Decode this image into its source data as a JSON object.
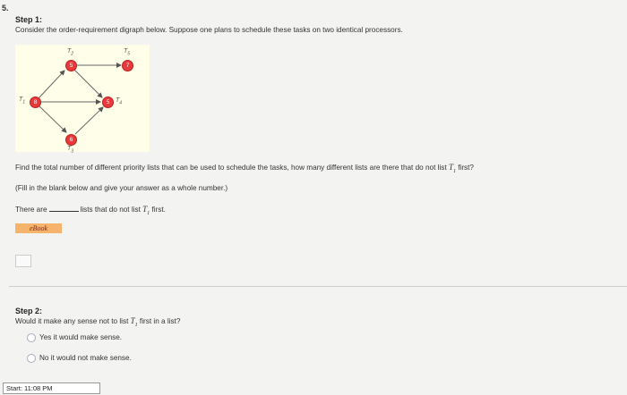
{
  "question_number": "5.",
  "step1": {
    "title": "Step 1:",
    "text": "Consider the order-requirement digraph below. Suppose one plans to schedule these tasks on two identical processors.",
    "graph": {
      "nodes": [
        {
          "id": "T1",
          "value": "8"
        },
        {
          "id": "T2",
          "value": "5"
        },
        {
          "id": "T3",
          "value": "6"
        },
        {
          "id": "T4",
          "value": "5"
        },
        {
          "id": "T5",
          "value": "7"
        }
      ],
      "labels": {
        "T1": "T",
        "T2": "T",
        "T3": "T",
        "T4": "T",
        "T5": "T"
      },
      "label_subs": {
        "T1": "1",
        "T2": "2",
        "T3": "3",
        "T4": "4",
        "T5": "5"
      }
    },
    "question_before_t1": "Find the total number of different priority lists that can be used to schedule the tasks, how many different lists are there that do not list ",
    "t1_var": "T",
    "t1_sub": "1",
    "question_after_t1": " first?",
    "instruction": "(Fill in the blank below and give your answer as a whole number.)",
    "answer_prefix": "There are",
    "answer_suffix_before": "lists that do not list ",
    "answer_suffix_after": " first.",
    "ebook_label": "eBook"
  },
  "step2": {
    "title": "Step 2:",
    "question_before": "Would it make any sense not to list ",
    "question_after": " first in a list?",
    "options": [
      "Yes it would make sense.",
      "No it would not make sense."
    ]
  },
  "status": {
    "start_label": "Start: 11:08 PM"
  },
  "colors": {
    "node_fill": "#e8393b",
    "graph_bg": "#ffffe9",
    "ebook_bg": "#f6b36b"
  }
}
